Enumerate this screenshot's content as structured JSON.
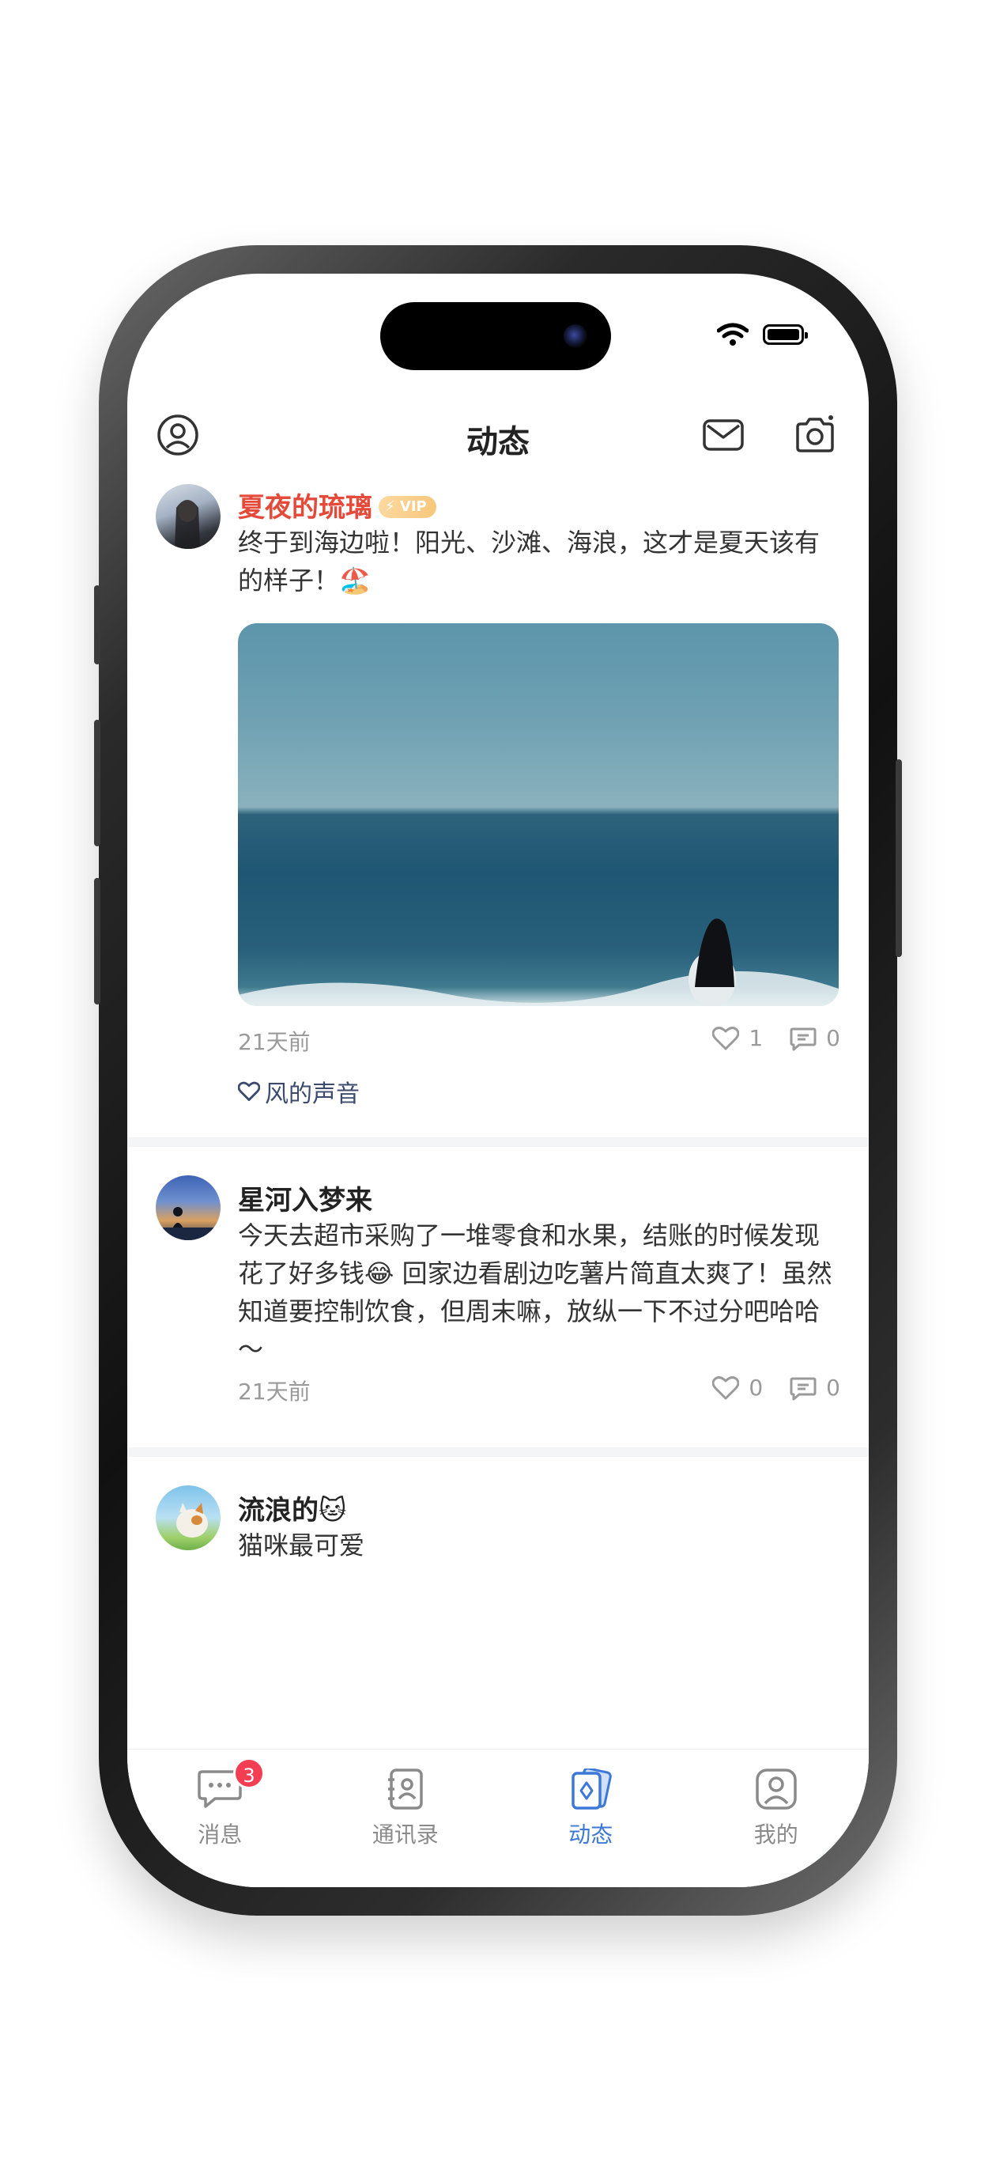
{
  "header": {
    "title": "动态"
  },
  "posts": [
    {
      "author": "夏夜的琉璃",
      "vip_label": "VIP",
      "content": "终于到海边啦！阳光、沙滩、海浪，这才是夏天该有的样子！🏖️",
      "time": "21天前",
      "likes": "1",
      "comments": "0",
      "liked_by": "风的声音"
    },
    {
      "author": "星河入梦来",
      "content": "今天去超市采购了一堆零食和水果，结账的时候发现花了好多钱😂 回家边看剧边吃薯片简直太爽了！虽然知道要控制饮食，但周末嘛，放纵一下不过分吧哈哈～",
      "time": "21天前",
      "likes": "0",
      "comments": "0"
    },
    {
      "author": "流浪的🐱",
      "content": "猫咪最可爱"
    }
  ],
  "tabbar": {
    "tabs": [
      {
        "label": "消息",
        "badge": "3"
      },
      {
        "label": "通讯录"
      },
      {
        "label": "动态"
      },
      {
        "label": "我的"
      }
    ]
  },
  "colors": {
    "accent": "#3d78d8",
    "vip_name": "#e5493a",
    "badge": "#f23d53"
  }
}
